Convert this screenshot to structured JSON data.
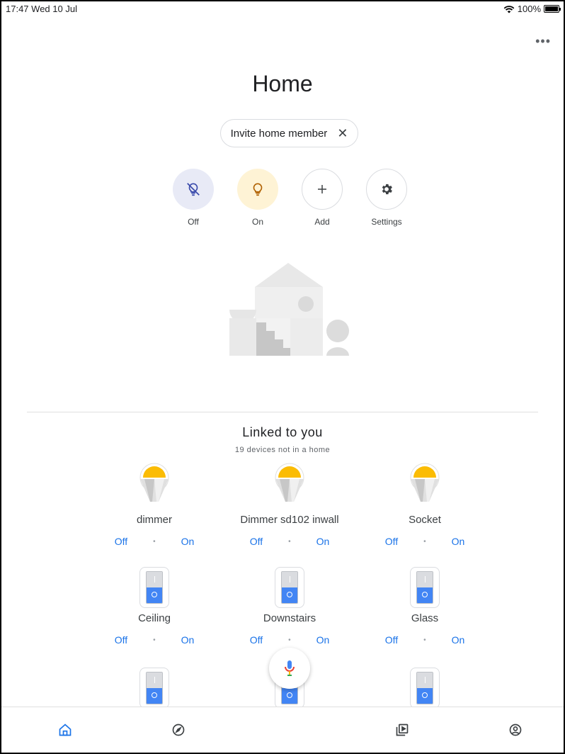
{
  "status_bar": {
    "time": "17:47",
    "date": "Wed 10 Jul",
    "battery": "100%",
    "battery_level": 1.0
  },
  "header": {
    "title": "Home",
    "more_icon": "more-horizontal-icon"
  },
  "invite_chip": {
    "label": "Invite home member",
    "close_icon": "close-icon"
  },
  "actions": [
    {
      "label": "Off",
      "icon": "lightbulb-off-icon",
      "bg": "#e8eaf6",
      "color": "#3949ab"
    },
    {
      "label": "On",
      "icon": "lightbulb-icon",
      "bg": "#fef3d5",
      "color": "#b06000"
    },
    {
      "label": "Add",
      "icon": "plus-icon",
      "bg": "#ffffff",
      "color": "#3c4043"
    },
    {
      "label": "Settings",
      "icon": "gear-icon",
      "bg": "#ffffff",
      "color": "#3c4043"
    }
  ],
  "linked": {
    "title": "Linked to you",
    "subtitle": "19 devices not in a home"
  },
  "devices": [
    {
      "name": "dimmer",
      "type": "bulb",
      "off": "Off",
      "on": "On"
    },
    {
      "name": "Dimmer sd102 inwall",
      "type": "bulb",
      "off": "Off",
      "on": "On"
    },
    {
      "name": "Socket",
      "type": "bulb",
      "off": "Off",
      "on": "On"
    },
    {
      "name": "Ceiling",
      "type": "switch",
      "off": "Off",
      "on": "On"
    },
    {
      "name": "Downstairs",
      "type": "switch",
      "off": "Off",
      "on": "On"
    },
    {
      "name": "Glass",
      "type": "switch",
      "off": "Off",
      "on": "On"
    }
  ],
  "bottom_nav": [
    {
      "name": "home-tab",
      "icon": "home-icon"
    },
    {
      "name": "discover-tab",
      "icon": "compass-icon"
    },
    {
      "name": "media-tab",
      "icon": "media-icon"
    },
    {
      "name": "account-tab",
      "icon": "account-icon"
    }
  ],
  "colors": {
    "accent": "#1a73e8",
    "bulb_yellow": "#fbbc04"
  }
}
